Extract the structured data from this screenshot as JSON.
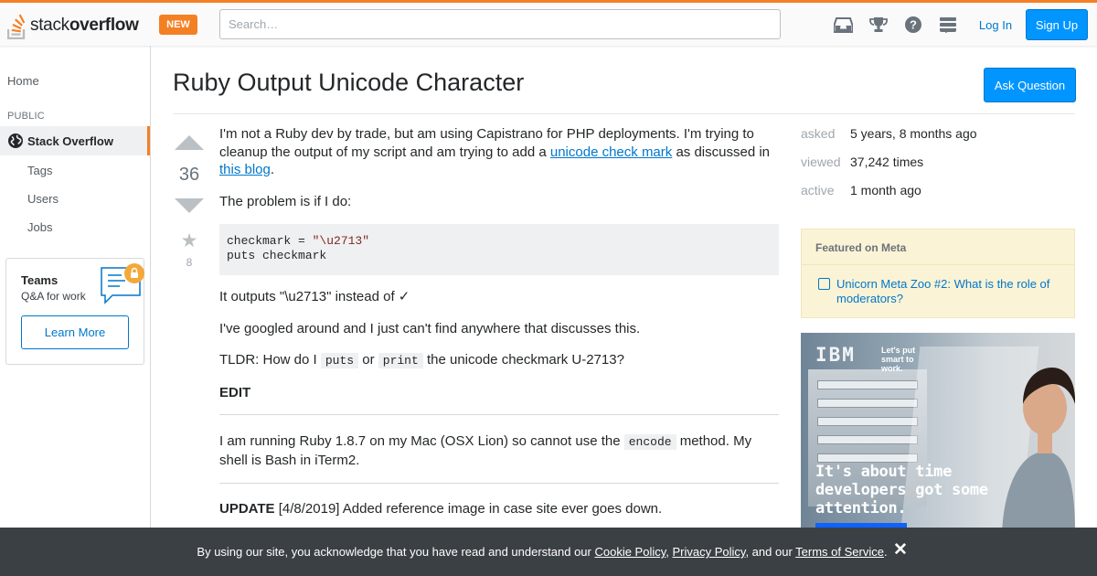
{
  "header": {
    "logo_regular": "stack",
    "logo_bold": "overflow",
    "new_badge": "NEW",
    "search_placeholder": "Search…",
    "login_label": "Log In",
    "signup_label": "Sign Up",
    "icons": [
      "inbox-icon",
      "achievements-icon",
      "help-icon",
      "site-switcher-icon"
    ]
  },
  "sidebar": {
    "home": "Home",
    "public_heading": "PUBLIC",
    "active_item": "Stack Overflow",
    "items": [
      "Tags",
      "Users",
      "Jobs"
    ],
    "teams": {
      "title": "Teams",
      "subtitle": "Q&A for work",
      "button": "Learn More"
    }
  },
  "question": {
    "title": "Ruby Output Unicode Character",
    "ask_button": "Ask Question",
    "votes": "36",
    "favorites": "8",
    "p1_before": "I'm not a Ruby dev by trade, but am using Capistrano for PHP deployments. I'm trying to cleanup the output of my script and am trying to add a ",
    "p1_link1": "unicode check mark",
    "p1_middle": " as discussed in ",
    "p1_link2": "this blog",
    "p1_after": ".",
    "p2": "The problem is if I do:",
    "code_line1_var": "checkmark = ",
    "code_line1_str": "\"\\u2713\"",
    "code_line2": "puts checkmark",
    "p3": "It outputs \"\\u2713\" instead of ✓",
    "p4": "I've googled around and I just can't find anywhere that discusses this.",
    "p5_before": "TLDR: How do I ",
    "p5_code1": "puts",
    "p5_middle": " or ",
    "p5_code2": "print",
    "p5_after": " the unicode checkmark U-2713?",
    "edit_heading": "EDIT",
    "p6_before": "I am running Ruby 1.8.7 on my Mac (OSX Lion) so cannot use the ",
    "p6_code": "encode",
    "p6_after": " method. My shell is Bash in iTerm2.",
    "update_label": "UPDATE",
    "update_text": " [4/8/2019] Added reference image in case site ever goes down."
  },
  "stats": {
    "asked_label": "asked",
    "asked_value": "5 years, 8 months ago",
    "viewed_label": "viewed",
    "viewed_value": "37,242 times",
    "active_label": "active",
    "active_value": "1 month ago"
  },
  "meta": {
    "heading": "Featured on Meta",
    "item": "Unicorn Meta Zoo #2: What is the role of moderators?"
  },
  "ad": {
    "brand": "IBM",
    "tagline": "Let's put smart to work.",
    "copy": "It's about time developers got some attention."
  },
  "cookie": {
    "text_before": "By using our site, you acknowledge that you have read and understand our ",
    "link1": "Cookie Policy",
    "sep1": ", ",
    "link2": "Privacy Policy",
    "sep2": ", and our ",
    "link3": "Terms of Service",
    "text_after": "."
  },
  "colors": {
    "accent": "#f48024",
    "link": "#0077cc",
    "primary_button": "#0095ff",
    "cookie_bar": "#3b4045"
  }
}
